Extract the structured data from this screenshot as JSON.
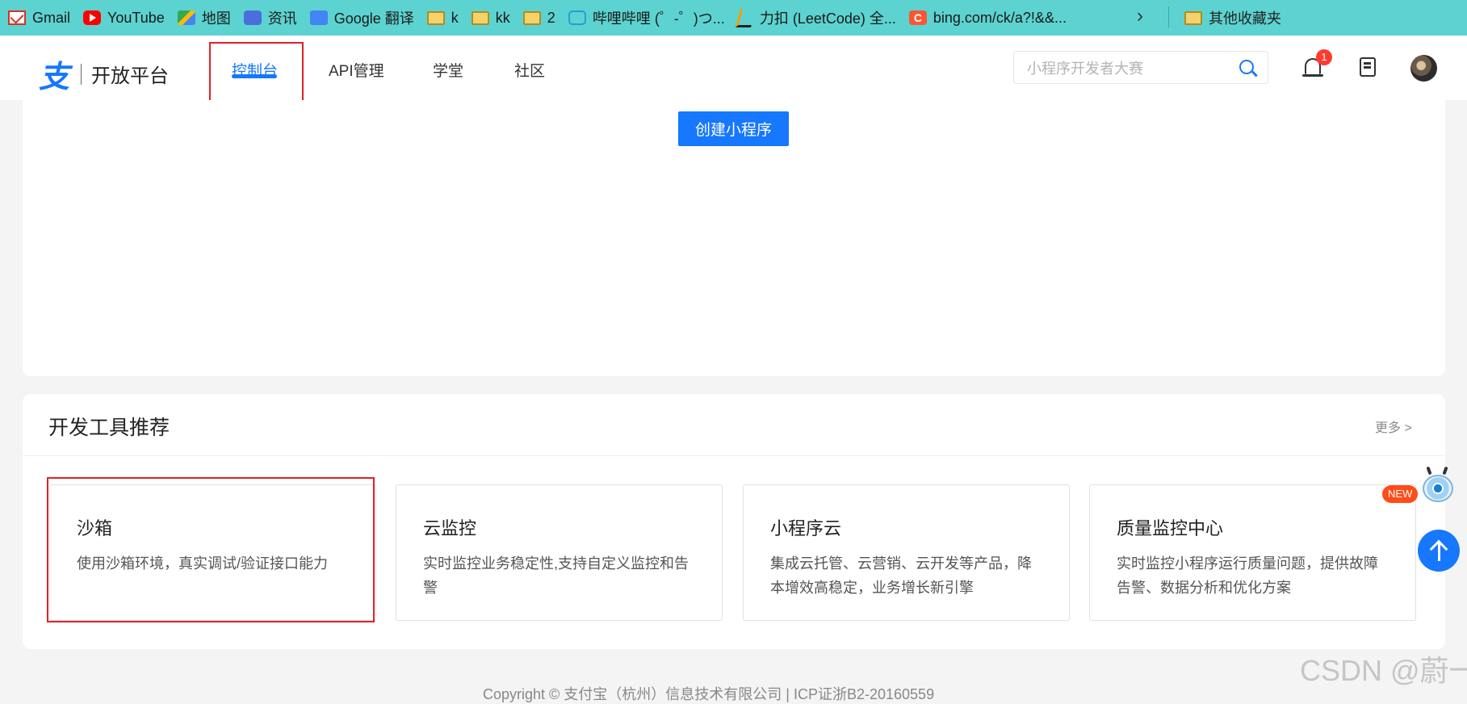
{
  "bookmarks": {
    "items": [
      {
        "label": "Gmail",
        "icon": "gmail-icon"
      },
      {
        "label": "YouTube",
        "icon": "youtube-icon"
      },
      {
        "label": "地图",
        "icon": "maps-icon"
      },
      {
        "label": "资讯",
        "icon": "news-icon"
      },
      {
        "label": "Google 翻译",
        "icon": "translate-icon"
      },
      {
        "label": "k",
        "icon": "folder-icon"
      },
      {
        "label": "kk",
        "icon": "folder-icon"
      },
      {
        "label": "2",
        "icon": "folder-icon"
      },
      {
        "label": "哔哩哔哩 (゜-゜)つ...",
        "icon": "bilibili-icon"
      },
      {
        "label": "力扣 (LeetCode) 全...",
        "icon": "leetcode-icon"
      },
      {
        "label": "bing.com/ck/a?!&&...",
        "icon": "csdn-icon"
      }
    ],
    "overflow": "›",
    "other": "其他收藏夹"
  },
  "header": {
    "logo_mark": "支",
    "logo_text": "开放平台",
    "nav": [
      "控制台",
      "API管理",
      "学堂",
      "社区"
    ],
    "active_nav": "控制台",
    "search_placeholder": "小程序开发者大赛",
    "notification_count": "1"
  },
  "top_card": {
    "create_button": "创建小程序"
  },
  "tools": {
    "title": "开发工具推荐",
    "more": "更多 >",
    "new_badge": "NEW",
    "cards": [
      {
        "title": "沙箱",
        "desc": "使用沙箱环境，真实调试/验证接口能力"
      },
      {
        "title": "云监控",
        "desc": "实时监控业务稳定性,支持自定义监控和告警"
      },
      {
        "title": "小程序云",
        "desc": "集成云托管、云营销、云开发等产品，降本增效高稳定，业务增长新引擎"
      },
      {
        "title": "质量监控中心",
        "desc": "实时监控小程序运行质量问题，提供故障告警、数据分析和优化方案"
      }
    ]
  },
  "footer": {
    "copyright": "Copyright © 支付宝（杭州）信息技术有限公司 | ICP证浙B2-20160559"
  },
  "watermark": "CSDN @蔚一",
  "colors": {
    "accent": "#1677ff",
    "highlight": "#e0202a",
    "bookmark_bar": "#5cd3d0"
  }
}
